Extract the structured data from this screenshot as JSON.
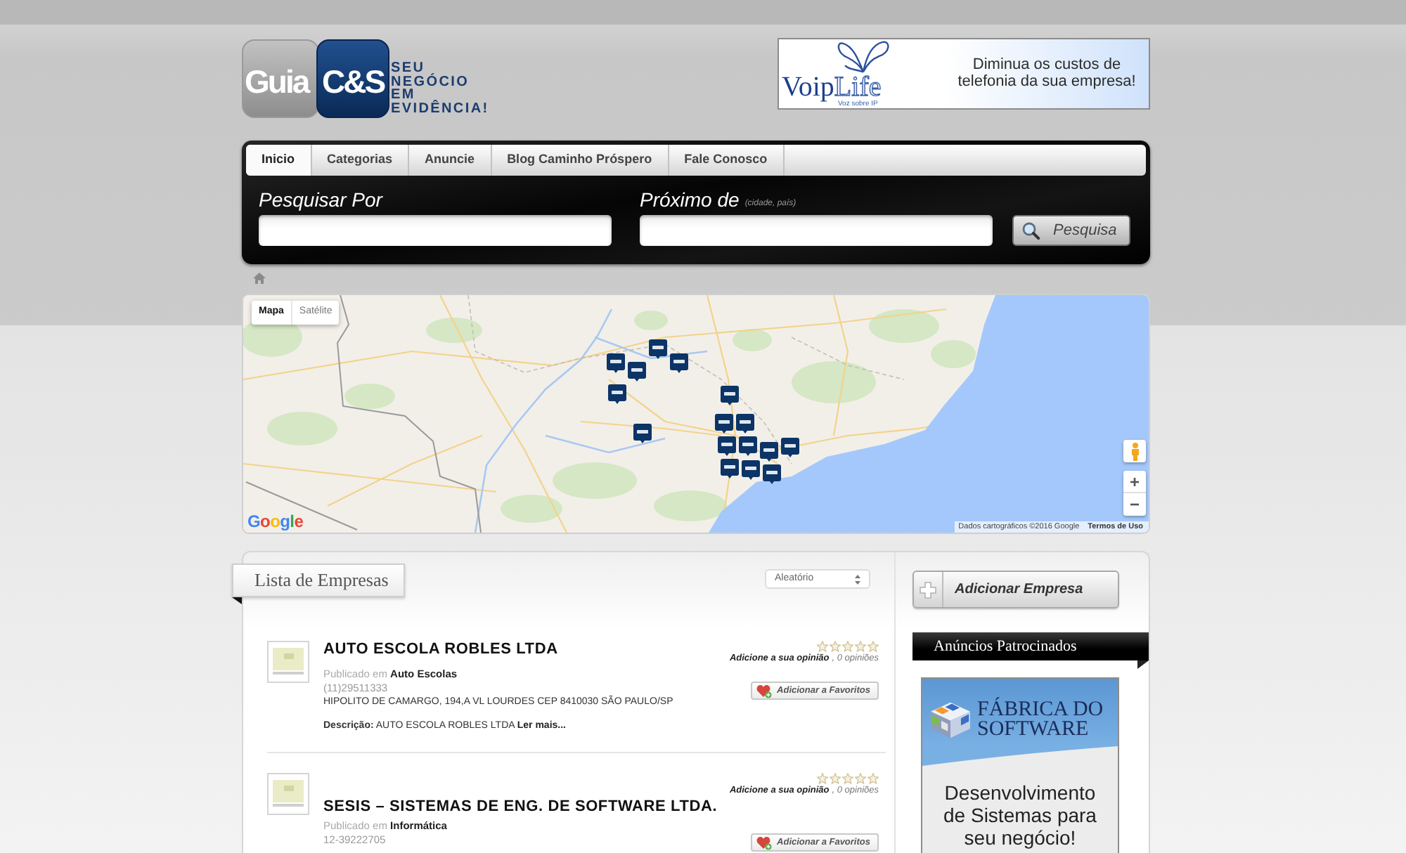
{
  "header": {
    "logo": {
      "left": "Guia",
      "right": "C&S",
      "tagline": "SEU NEGÓCIO EM EVIDÊNCIA!"
    },
    "banner": {
      "brand": [
        "Voip",
        "Life"
      ],
      "subtitle": "Voz sobre IP",
      "text": "Diminua os custos de telefonia da sua empresa!"
    }
  },
  "nav": {
    "tabs": [
      {
        "label": "Inicio",
        "selected": true
      },
      {
        "label": "Categorias",
        "selected": false
      },
      {
        "label": "Anuncie",
        "selected": false
      },
      {
        "label": "Blog Caminho Próspero",
        "selected": false
      },
      {
        "label": "Fale Conosco",
        "selected": false
      }
    ]
  },
  "search": {
    "query_label": "Pesquisar Por",
    "location_label": "Próximo de",
    "location_label_hint": "(cidade, país)",
    "button": "Pesquisa"
  },
  "map": {
    "types": [
      {
        "label": "Mapa",
        "selected": true
      },
      {
        "label": "Satélite",
        "selected": false
      }
    ],
    "zoom_in": "+",
    "zoom_out": "−",
    "logo": "Google",
    "attribution": "Dados cartográficos ©2016 Google",
    "terms": "Termos de Uso"
  },
  "listing": {
    "title": "Lista de Empresas",
    "sort": "Aleatório",
    "items": [
      {
        "name": "AUTO ESCOLA ROBLES LTDA",
        "stars": 0,
        "review_link": "Adicione a sua opinião",
        "review_count": ", 0 opiniões",
        "published_label": "Publicado em",
        "category": "Auto Escolas",
        "favorite_button": "Adicionar a Favoritos",
        "phone": "(11)29511333",
        "address": "HIPOLITO DE CAMARGO, 194,A VL LOURDES CEP 8410030 SÃO PAULO/SP",
        "description": "**Descrição:** AUTO ESCOLA ROBLES LTDA",
        "read_more": "Ler mais..."
      },
      {
        "name": "SESIS – SISTEMAS DE ENG. DE SOFTWARE LTDA.",
        "stars": 0,
        "review_link": "Adicione a sua opinião",
        "review_count": ", 0 opiniões",
        "published_label": "Publicado em",
        "category": "Informática",
        "favorite_button": "Adicionar a Favoritos",
        "phone": "12-39222705"
      }
    ]
  },
  "sidebar": {
    "add_button": "Adicionar Empresa",
    "ads_title": "Anúncios Patrocinados",
    "ad": {
      "brand": "FÁBRICA DO SOFTWARE",
      "text": "Desenvolvimento de Sistemas para seu negócio!"
    }
  }
}
